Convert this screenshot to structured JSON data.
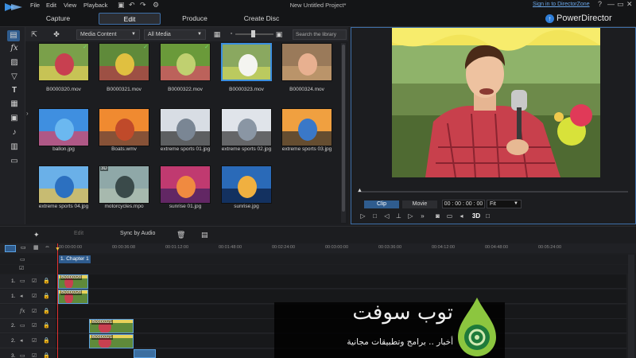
{
  "menubar": {
    "items": [
      "File",
      "Edit",
      "View",
      "Playback"
    ],
    "window_title": "New Untitled Project*",
    "signin": "Sign in to DirectorZone",
    "window_controls": [
      "?",
      "—",
      "▭",
      "✕"
    ]
  },
  "modes": {
    "tabs": [
      "Capture",
      "Edit",
      "Produce",
      "Create Disc"
    ],
    "active": "Edit",
    "brand": "PowerDirector"
  },
  "library": {
    "content_dropdown": "Media Content",
    "filter_dropdown": "All Media",
    "search_placeholder": "Search the library",
    "items": [
      {
        "name": "B0000320.mov",
        "checked": true,
        "threeD": false
      },
      {
        "name": "B0000321.mov",
        "checked": true,
        "threeD": false
      },
      {
        "name": "B0000322.mov",
        "checked": true,
        "threeD": false
      },
      {
        "name": "B0000323.mov",
        "checked": false,
        "threeD": false,
        "selected": true
      },
      {
        "name": "B0000324.mov",
        "checked": false,
        "threeD": false
      },
      {
        "name": "ballon.jpg",
        "checked": false,
        "threeD": false
      },
      {
        "name": "Boats.wmv",
        "checked": false,
        "threeD": false
      },
      {
        "name": "extreme sports 01.jpg",
        "checked": false,
        "threeD": false
      },
      {
        "name": "extreme sports 02.jpg",
        "checked": false,
        "threeD": false
      },
      {
        "name": "extreme sports 03.jpg",
        "checked": false,
        "threeD": false
      },
      {
        "name": "extreme sports 04.jpg",
        "checked": false,
        "threeD": false
      },
      {
        "name": "motorcycles.mpo",
        "checked": false,
        "threeD": true
      },
      {
        "name": "sunrise 01.jpg",
        "checked": false,
        "threeD": false
      },
      {
        "name": "sunrise.jpg",
        "checked": false,
        "threeD": false
      }
    ],
    "badge_3d": "3D",
    "check_mark": "✓"
  },
  "preview": {
    "tabs": [
      "Clip",
      "Movie"
    ],
    "active_tab": "Clip",
    "timecode": "00 : 00 : 00 : 00",
    "fit": "Fit",
    "threeD_label": "3D"
  },
  "edit_toolbar": {
    "edit": "Edit",
    "sync_by_audio": "Sync by Audio"
  },
  "timeline": {
    "ruler": [
      "00:00:00:00",
      "00:00:36:08",
      "00:01:12:00",
      "00:01:48:00",
      "00:02:24:00",
      "00:03:00:00",
      "00:03:36:00",
      "00:04:12:00",
      "00:04:48:00",
      "00:05:24:00"
    ],
    "chapter": "1. Chapter 1",
    "tracks": [
      {
        "num": "1.",
        "type": "video"
      },
      {
        "num": "1.",
        "type": "audio"
      },
      {
        "num": "",
        "type": "fx"
      },
      {
        "num": "2.",
        "type": "video"
      },
      {
        "num": "2.",
        "type": "audio"
      },
      {
        "num": "3.",
        "type": "video"
      }
    ],
    "clips": [
      {
        "label": "B0000320",
        "track": 0
      },
      {
        "label": "B0000320",
        "track": 1
      },
      {
        "label": "B0000321",
        "track": 3
      },
      {
        "label": "B0000321",
        "track": 4
      }
    ]
  },
  "watermark": {
    "title": "توب سوفت",
    "subtitle": "أخبار .. برامج وتطبيقات مجانية"
  },
  "colors": {
    "accent": "#2f7ed8",
    "selection": "#3b8fe0",
    "playhead": "#e03030",
    "check": "#6fdc6f"
  }
}
